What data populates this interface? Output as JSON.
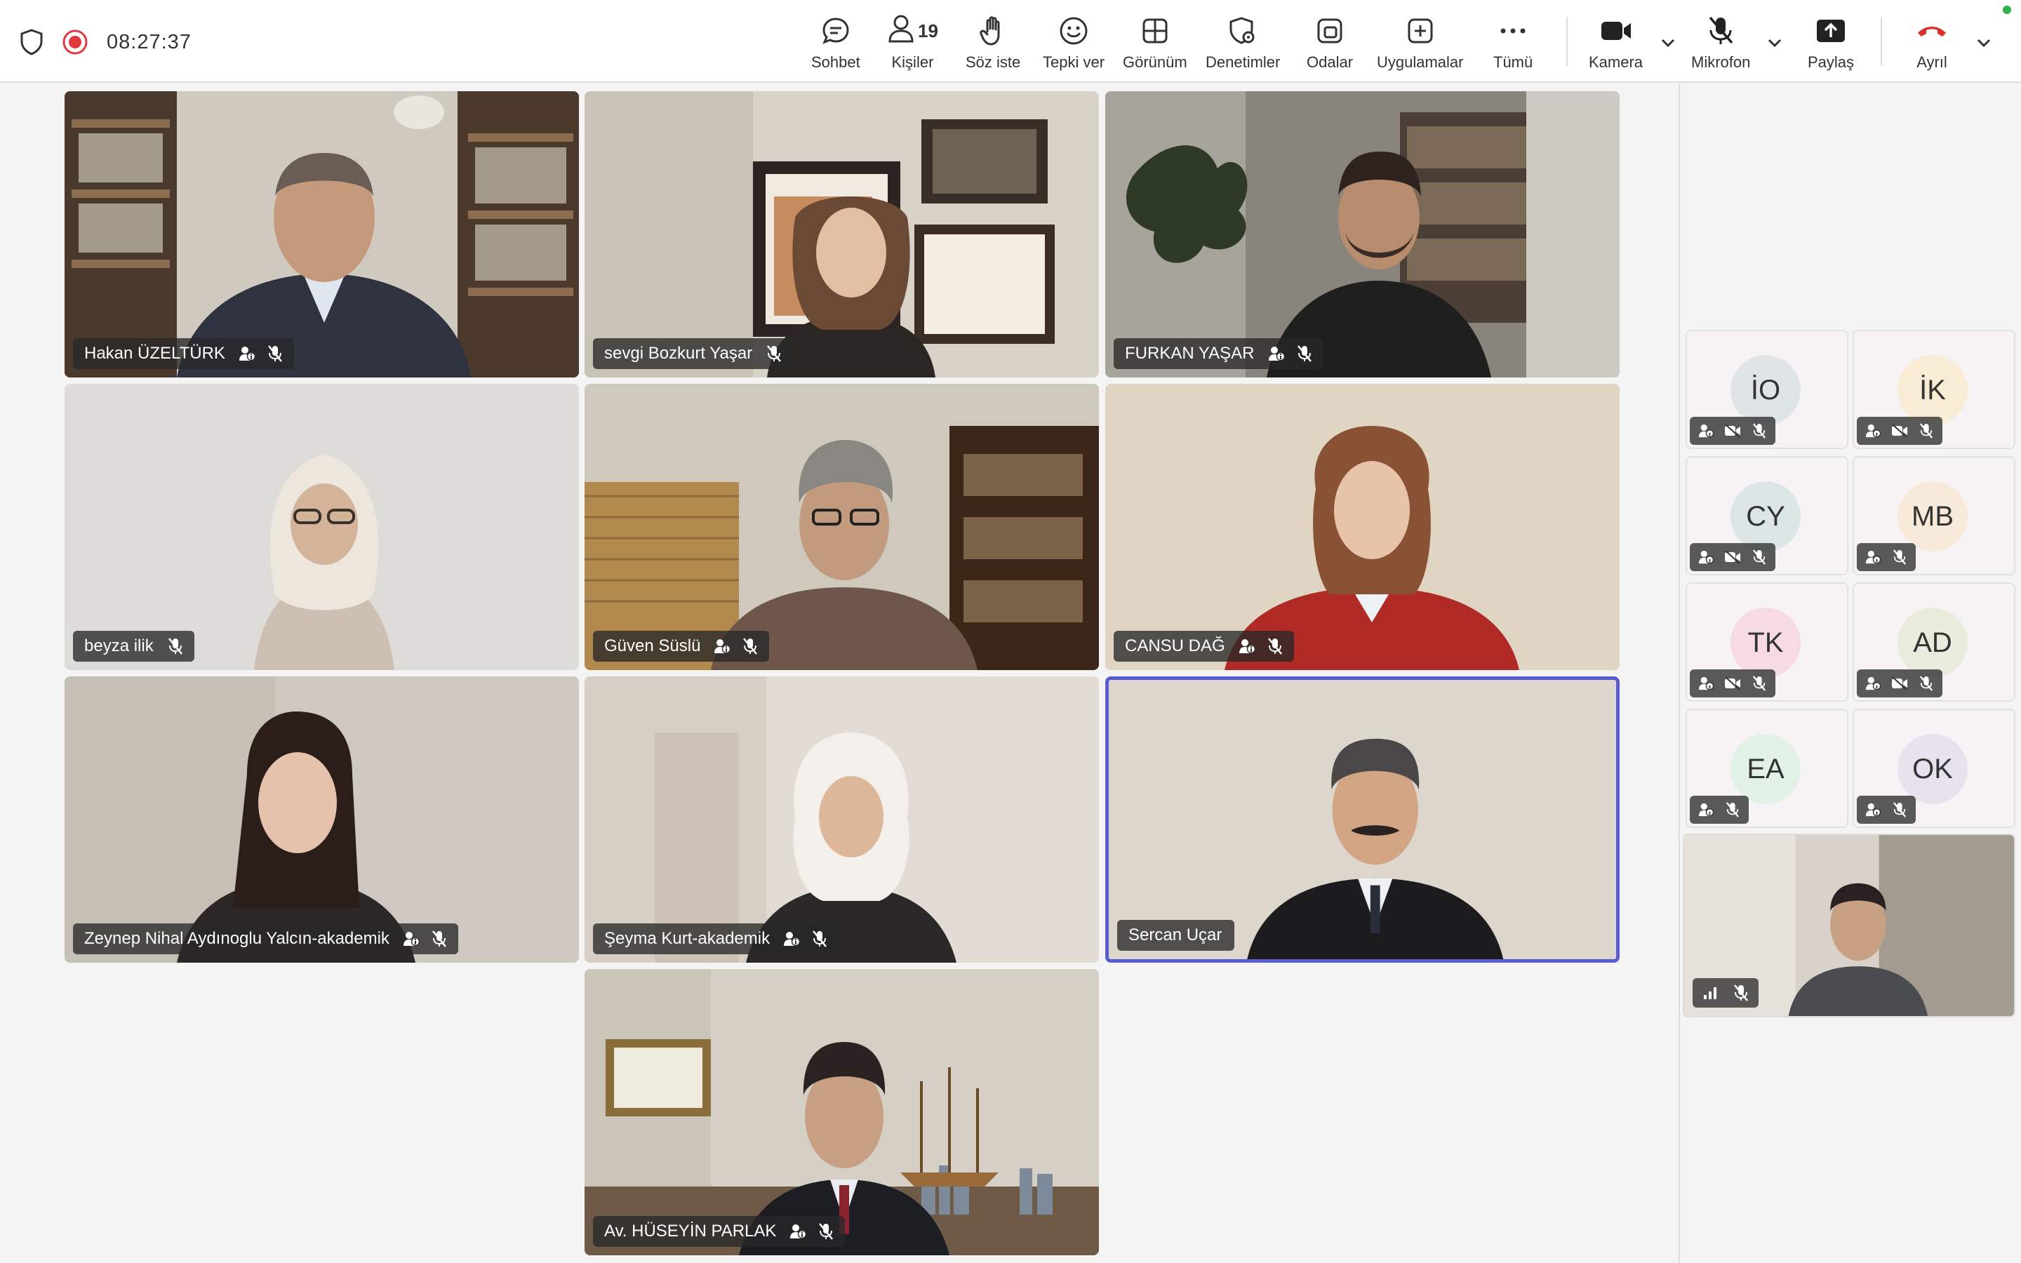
{
  "status": {
    "timer": "08:27:37"
  },
  "toolbar": {
    "chat": "Sohbet",
    "people": "Kişiler",
    "people_count": "19",
    "raise_hand": "Söz iste",
    "react": "Tepki ver",
    "view": "Görünüm",
    "controls": "Denetimler",
    "rooms": "Odalar",
    "apps": "Uygulamalar",
    "more": "Tümü",
    "camera": "Kamera",
    "mic": "Mikrofon",
    "share": "Paylaş",
    "leave": "Ayrıl"
  },
  "participants": [
    {
      "name": "Hakan ÜZELTÜRK"
    },
    {
      "name": "sevgi Bozkurt Yaşar"
    },
    {
      "name": "FURKAN YAŞAR"
    },
    {
      "name": "beyza ilik"
    },
    {
      "name": "Güven Süslü"
    },
    {
      "name": "CANSU DAĞ"
    },
    {
      "name": "Zeynep Nihal Aydınoglu Yalcın-akademik"
    },
    {
      "name": "Şeyma Kurt-akademik"
    },
    {
      "name": "Sercan Uçar"
    },
    {
      "name": "Av. HÜSEYİN PARLAK"
    }
  ],
  "side_participants": [
    {
      "initials": "İO",
      "color": "#dfe4e6"
    },
    {
      "initials": "İK",
      "color": "#f8ecd4"
    },
    {
      "initials": "CY",
      "color": "#dde6e6"
    },
    {
      "initials": "MB",
      "color": "#f8ead9"
    },
    {
      "initials": "TK",
      "color": "#f6dbe4"
    },
    {
      "initials": "AD",
      "color": "#e9ecdc"
    },
    {
      "initials": "EA",
      "color": "#e2f1e6"
    },
    {
      "initials": "OK",
      "color": "#e6e3ef"
    }
  ]
}
